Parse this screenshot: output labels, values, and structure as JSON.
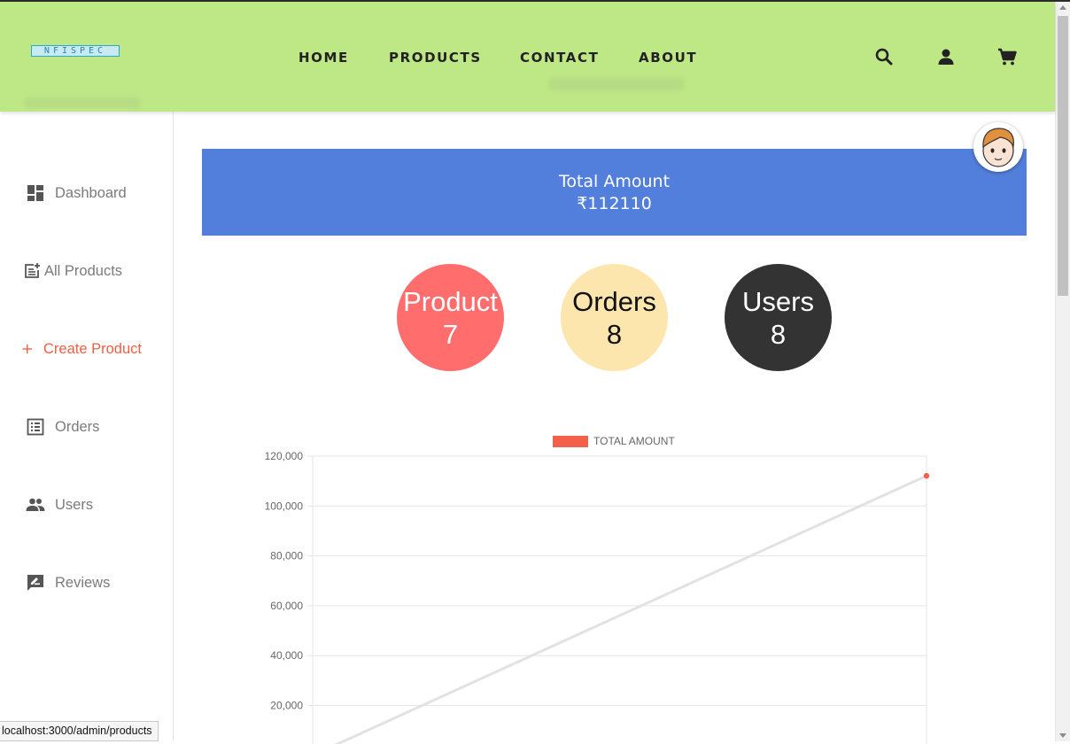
{
  "header": {
    "logo_text": "NFISPEC",
    "nav": [
      "HOME",
      "PRODUCTS",
      "CONTACT",
      "ABOUT"
    ],
    "icons": [
      "search-icon",
      "user-icon",
      "cart-icon"
    ],
    "background": "#bee786"
  },
  "sidebar": {
    "items": [
      {
        "label": "Dashboard",
        "icon": "dashboard-icon"
      },
      {
        "label": "All Products",
        "icon": "post-add-icon"
      },
      {
        "label": "Create Product",
        "icon": "plus-icon",
        "active": true
      },
      {
        "label": "Orders",
        "icon": "list-alt-icon"
      },
      {
        "label": "Users",
        "icon": "people-icon"
      },
      {
        "label": "Reviews",
        "icon": "rate-review-icon"
      }
    ],
    "active_color": "#ec6144"
  },
  "summary": {
    "title": "Total Amount",
    "amount": "₹112110",
    "color": "#527fdb"
  },
  "stats": [
    {
      "label": "Product",
      "value": "7",
      "color": "#ff6d6d"
    },
    {
      "label": "Orders",
      "value": "8",
      "color": "#fde6ad"
    },
    {
      "label": "Users",
      "value": "8",
      "color": "#333333"
    }
  ],
  "chart_data": {
    "type": "line",
    "legend": "TOTAL AMOUNT",
    "legend_position": "top",
    "legend_color": "#f4614a",
    "line_color": "#e2e2e2",
    "point_color": "#f4614a",
    "x": [
      0,
      1
    ],
    "values": [
      0,
      112110
    ],
    "ylim": [
      0,
      120000
    ],
    "yticks": [
      "120,000",
      "100,000",
      "80,000",
      "60,000",
      "40,000",
      "20,000"
    ],
    "grid": true
  },
  "status_bar": {
    "url": "localhost:3000/admin/products"
  }
}
